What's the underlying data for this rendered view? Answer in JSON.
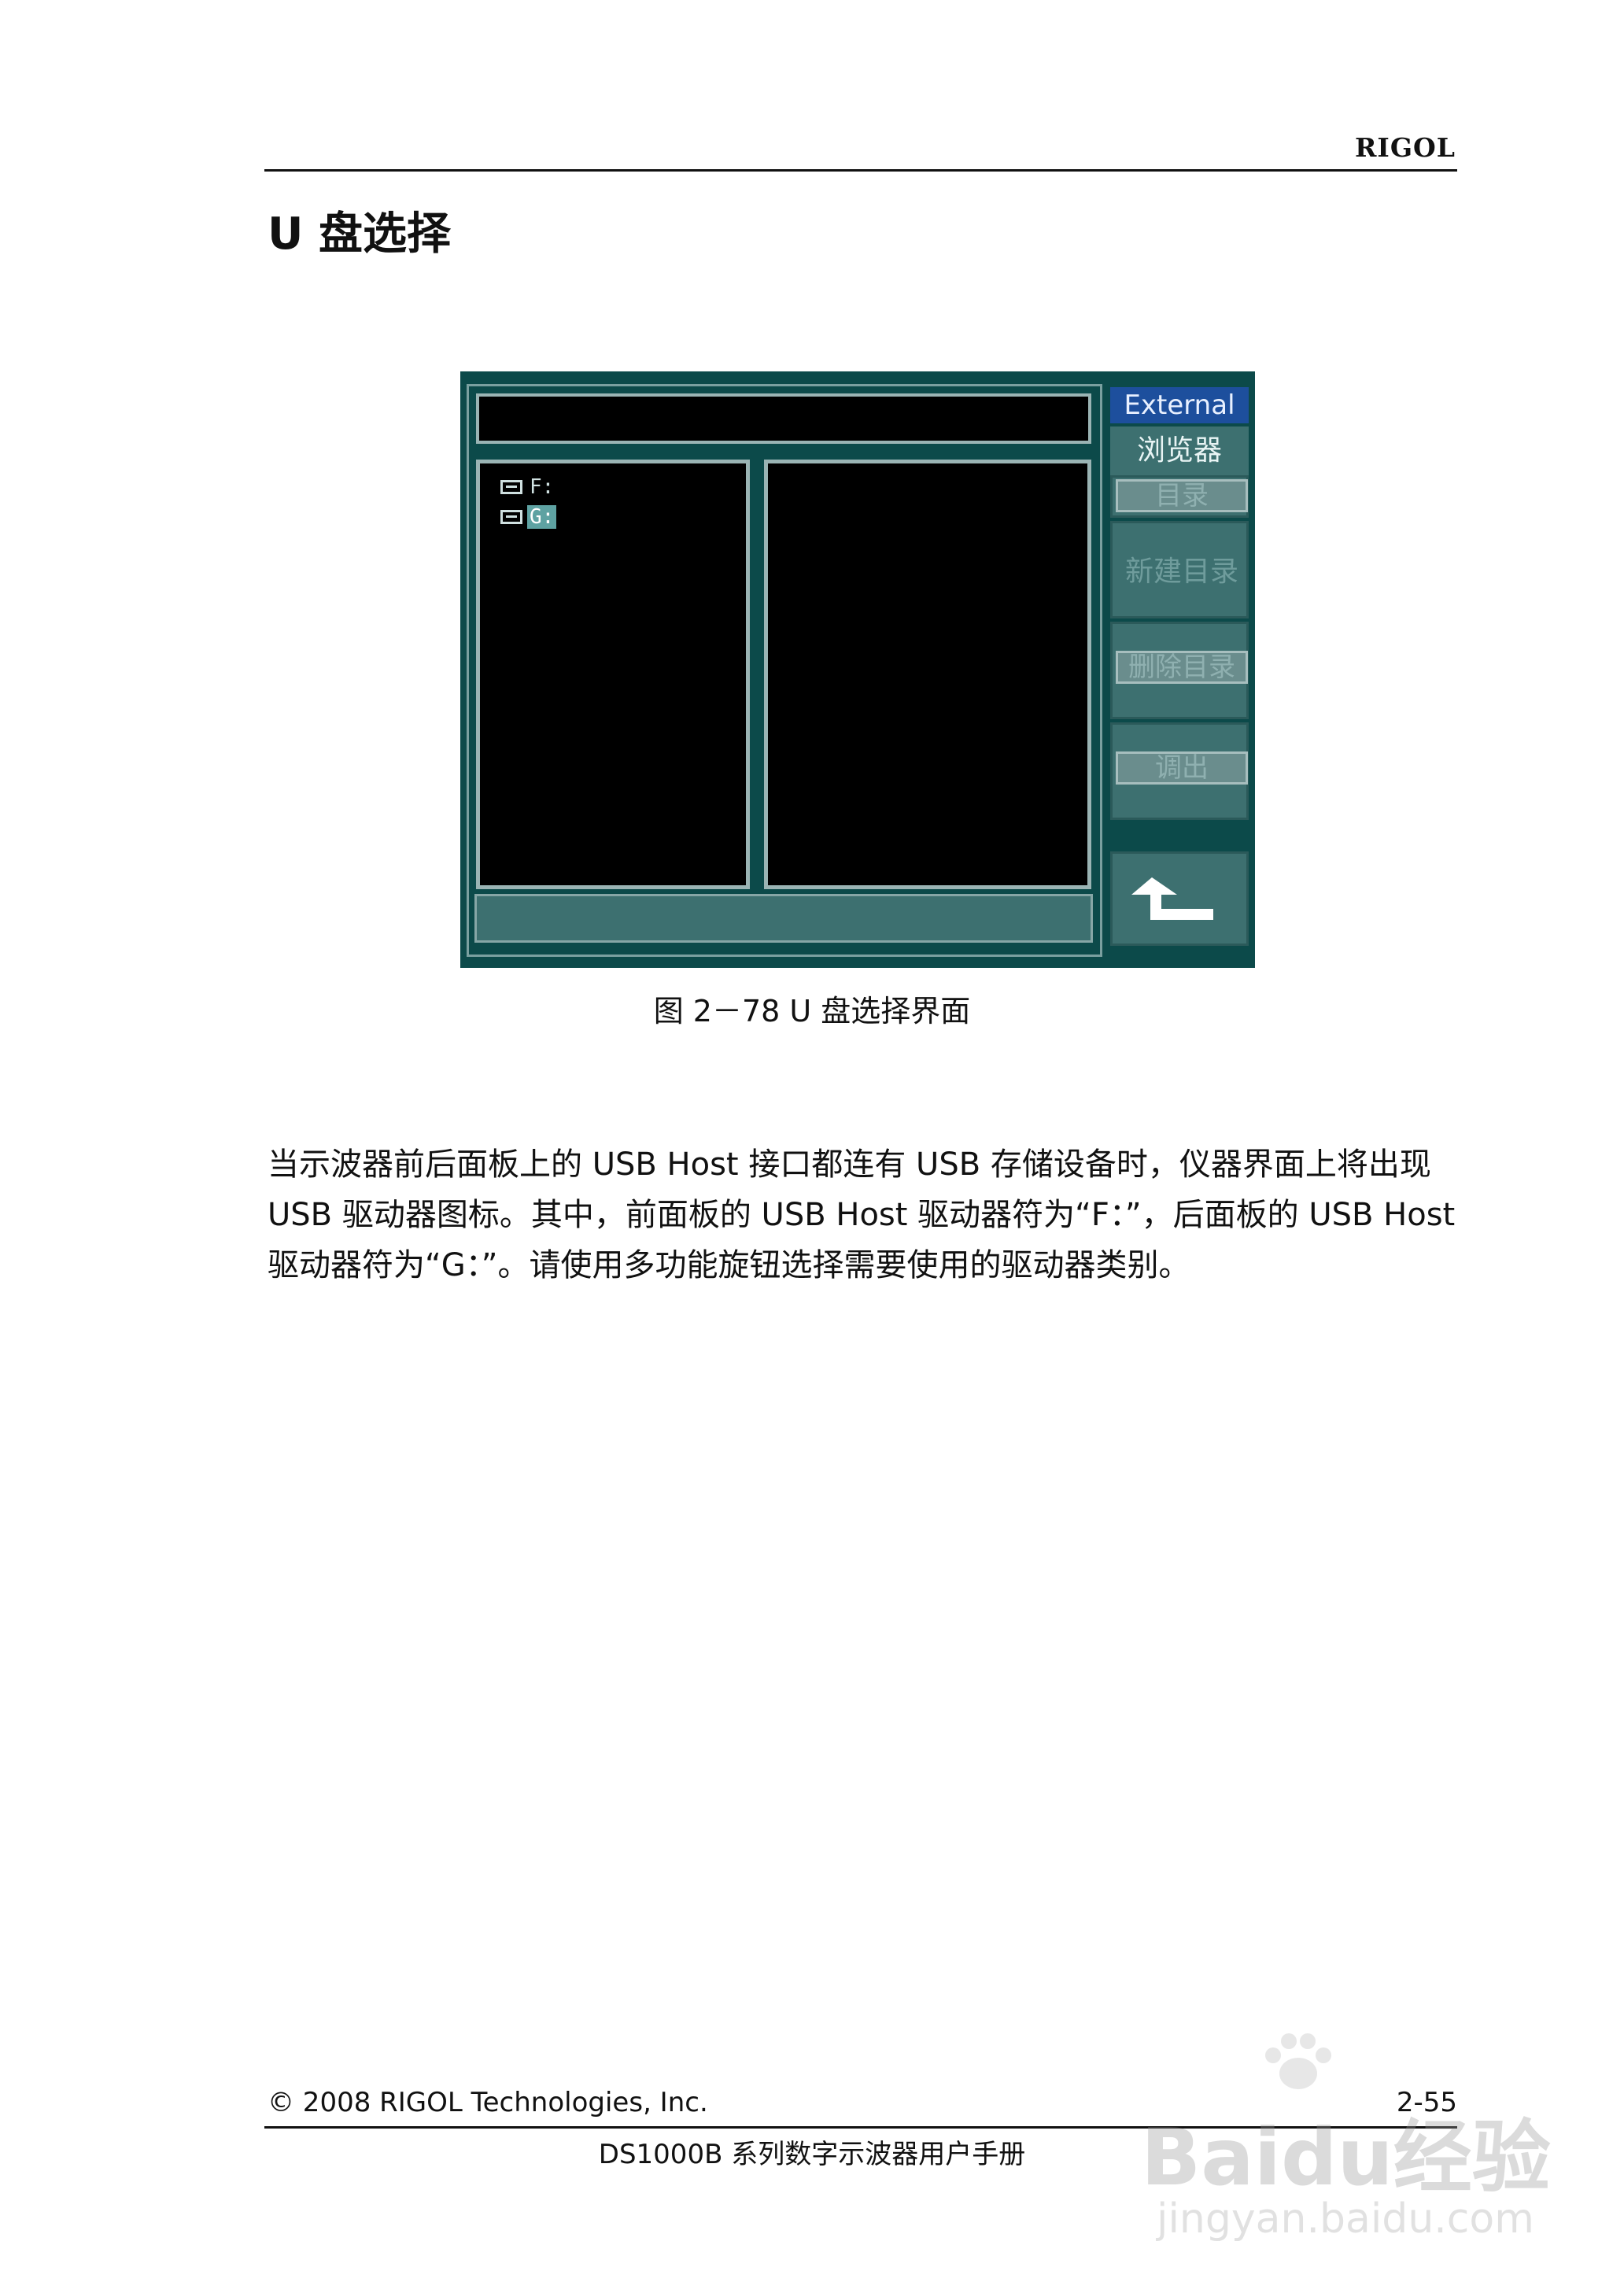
{
  "header": {
    "brand": "RIGOL"
  },
  "section": {
    "title": "U 盘选择"
  },
  "figure": {
    "menu_title": "External",
    "menu_subtitle": "浏览器",
    "softkeys": [
      "目录",
      "新建目录",
      "删除目录",
      "调出"
    ],
    "back_icon": "back-arrow-icon",
    "drives": [
      {
        "label": "F:",
        "selected": false,
        "icon": "drive-icon"
      },
      {
        "label": "G:",
        "selected": true,
        "icon": "drive-icon"
      }
    ],
    "caption": "图 2－78 U 盘选择界面",
    "colors": {
      "screen_bg": "#0c4a4a",
      "title_bar": "#1d4f9d",
      "selected": "#5ea2a2"
    }
  },
  "body": {
    "lines": [
      "当示波器前后面板上的 USB Host 接口都连有 USB 存储设备时，仪器界面上将出现",
      "USB 驱动器图标。其中，前面板的 USB Host 驱动器符为“F：”，后面板的 USB Host",
      "驱动器符为“G：”。请使用多功能旋钮选择需要使用的驱动器类别。"
    ]
  },
  "footer": {
    "copyright": "© 2008 RIGOL Technologies, Inc.",
    "page": "2-55",
    "manual": "DS1000B 系列数字示波器用户手册"
  },
  "watermark": {
    "brand": "Baidu经验",
    "url": "jingyan.baidu.com"
  }
}
